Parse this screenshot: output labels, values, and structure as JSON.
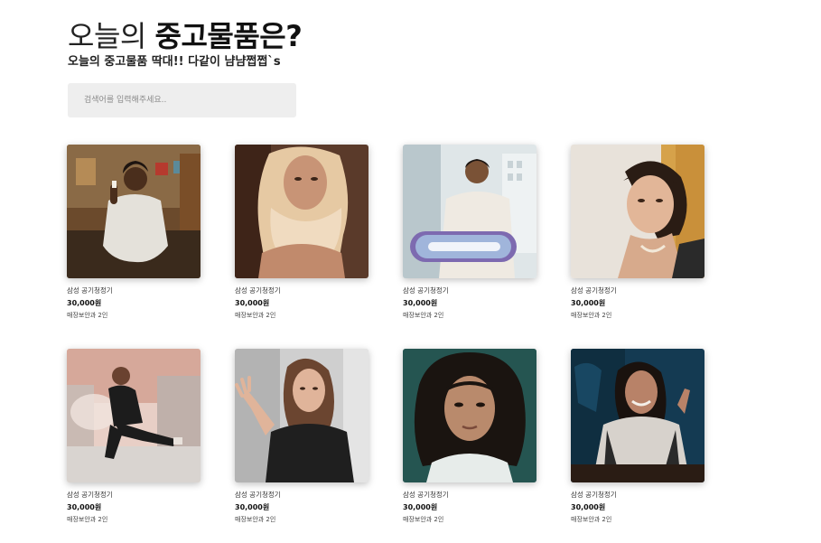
{
  "header": {
    "title_light": "오늘의",
    "title_bold": "중고물품은?",
    "subtitle": "오늘의 중고물품 딱대!! 다같이 냠냠쩝쩝`s"
  },
  "search": {
    "placeholder": "검색어를 입력해주세요..",
    "value": ""
  },
  "products": [
    {
      "name": "삼성 공기청정기",
      "price": "30,000원",
      "meta": "매장보안과 2인",
      "photo": "photo-woman-white-top"
    },
    {
      "name": "삼성 공기청정기",
      "price": "30,000원",
      "meta": "매장보안과 2인",
      "photo": "photo-woman-beige-scarf"
    },
    {
      "name": "삼성 공기청정기",
      "price": "30,000원",
      "meta": "매장보안과 2인",
      "photo": "photo-man-with-sign"
    },
    {
      "name": "삼성 공기청정기",
      "price": "30,000원",
      "meta": "매장보안과 2인",
      "photo": "photo-woman-necklace"
    },
    {
      "name": "삼성 공기청정기",
      "price": "30,000원",
      "meta": "매장보안과 2인",
      "photo": "photo-woman-smoke-rooftop"
    },
    {
      "name": "삼성 공기청정기",
      "price": "30,000원",
      "meta": "매장보안과 2인",
      "photo": "photo-woman-reaching-hand"
    },
    {
      "name": "삼성 공기청정기",
      "price": "30,000원",
      "meta": "매장보안과 2인",
      "photo": "photo-woman-curly-hair"
    },
    {
      "name": "삼성 공기청정기",
      "price": "30,000원",
      "meta": "매장보안과 2인",
      "photo": "photo-woman-smiling-jacket"
    }
  ]
}
